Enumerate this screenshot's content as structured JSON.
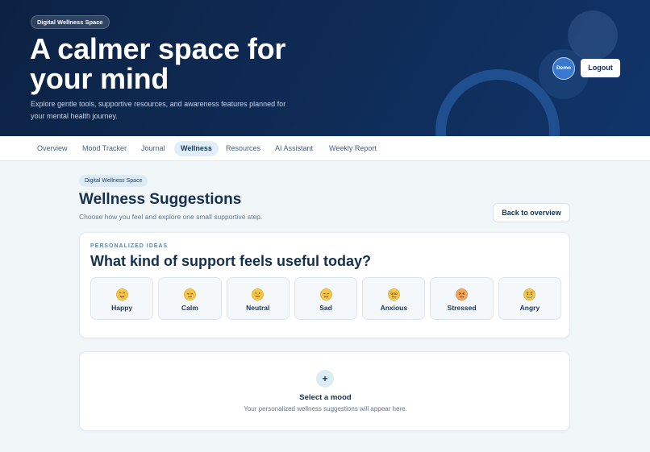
{
  "hero": {
    "badge": "Digital Wellness Space",
    "title": "A calmer space for your mind",
    "subtitle": "Explore gentle tools, supportive resources, and awareness features planned for your mental health journey.",
    "avatar_text": "Demo",
    "logout_label": "Logout"
  },
  "nav": {
    "items": [
      {
        "label": "Overview"
      },
      {
        "label": "Mood Tracker"
      },
      {
        "label": "Journal"
      },
      {
        "label": "Wellness",
        "active": true
      },
      {
        "label": "Resources"
      },
      {
        "label": "AI Assistant"
      },
      {
        "label": "Weekly Report"
      }
    ]
  },
  "page": {
    "badge": "Digital Wellness Space",
    "title": "Wellness Suggestions",
    "subtitle": "Choose how you feel and explore one small supportive step.",
    "back_label": "Back to overview"
  },
  "mood_card": {
    "eyebrow": "PERSONALIZED IDEAS",
    "heading": "What kind of support feels useful today?",
    "moods": [
      {
        "label": "Happy",
        "icon": "happy-face-icon"
      },
      {
        "label": "Calm",
        "icon": "calm-face-icon"
      },
      {
        "label": "Neutral",
        "icon": "neutral-face-icon"
      },
      {
        "label": "Sad",
        "icon": "sad-face-icon"
      },
      {
        "label": "Anxious",
        "icon": "anxious-face-icon"
      },
      {
        "label": "Stressed",
        "icon": "stressed-face-icon"
      },
      {
        "label": "Angry",
        "icon": "angry-face-icon"
      }
    ]
  },
  "empty_state": {
    "icon": "plus-icon",
    "title": "Select a mood",
    "subtitle": "Your personalized wellness suggestions will appear here."
  },
  "colors": {
    "hero_bg": "#0f2c57",
    "accent": "#3a78d0",
    "text_dark": "#14304f",
    "emoji_face": "#f5c544"
  }
}
